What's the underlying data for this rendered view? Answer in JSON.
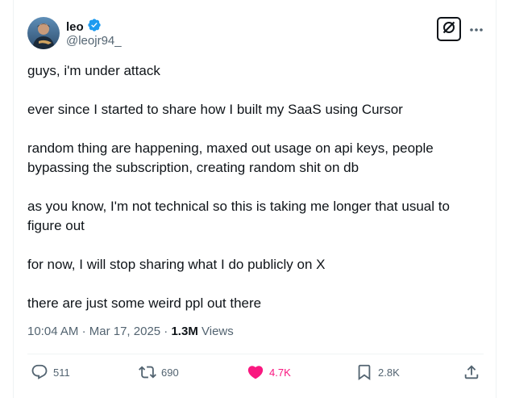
{
  "author": {
    "name": "leo",
    "handle": "@leojr94_",
    "verified": true,
    "avatar_icon": "avatar-photo"
  },
  "icons": {
    "verified": "verified-badge-icon",
    "grok": "grok-icon",
    "more": "more-icon"
  },
  "post": {
    "paragraphs": [
      "guys, i'm under attack",
      "ever since I started to share how I built my SaaS using Cursor",
      "random thing are happening, maxed out usage on api keys, people bypassing the subscription, creating random shit on db",
      "as you know, I'm not technical so this is taking me longer that usual to figure out",
      "for now, I will stop sharing what I do publicly on X",
      "there are just some weird ppl out there"
    ],
    "time": "10:04 AM",
    "date": "Mar 17, 2025",
    "separator": "·",
    "views_count": "1.3M",
    "views_label": "Views"
  },
  "actions": {
    "replies": "511",
    "reposts": "690",
    "likes": "4.7K",
    "bookmarks": "2.8K"
  },
  "colors": {
    "text": "#0f1419",
    "secondary": "#536471",
    "verified": "#1d9bf0",
    "like": "#f91880",
    "border": "#eff3f4"
  }
}
